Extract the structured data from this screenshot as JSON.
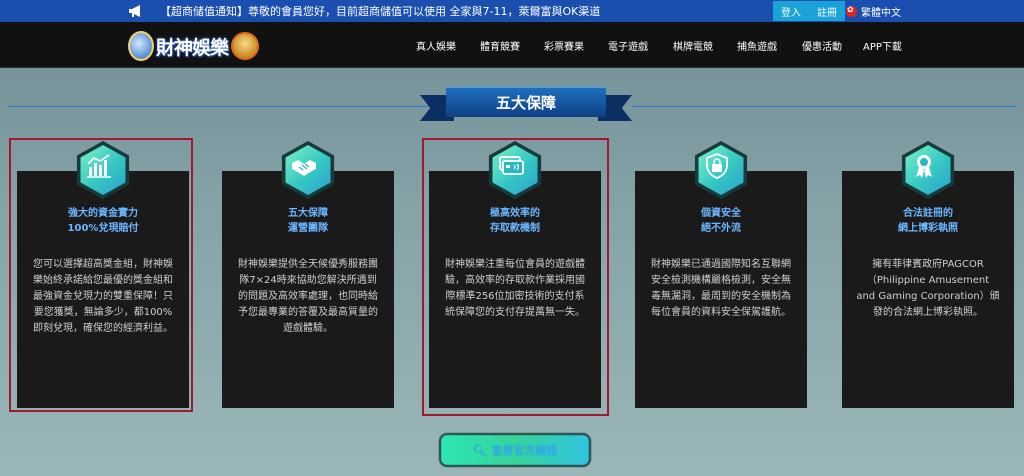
{
  "topbar": {
    "announcement": "【超商储值通知】尊敬的會員您好，目前超商儲值可以使用 全家與7-11，萊爾富與OK渠道",
    "login": "登入",
    "register": "註冊",
    "language": "繁體中文"
  },
  "brand": {
    "logo_text": "財神娛樂"
  },
  "nav": [
    "真人娛樂",
    "體育競賽",
    "彩票賽果",
    "電子遊戲",
    "棋牌電競",
    "捕魚遊戲",
    "優惠活動",
    "APP下載"
  ],
  "section": {
    "title": "五大保障"
  },
  "cards": [
    {
      "icon": "bar-chart-icon",
      "title_line1": "強大的資金實力",
      "title_line2": "100%兌現賠付",
      "desc": "您可以選擇超高獎金組，財神娛樂始終承諾給您最優的獎金組和最強資金兌現力的雙重保障！只要您獲獎，無論多少，都100%即刻兌現，確保您的經濟利益。"
    },
    {
      "icon": "handshake-icon",
      "title_line1": "五大保障",
      "title_line2": "運營團隊",
      "desc": "財神娛樂提供全天候優秀服務團隊7×24時來協助您解決所遇到的問題及高效率處理，也同時給予您最專業的答覆及最高質量的遊戲體驗。"
    },
    {
      "icon": "credit-card-icon",
      "title_line1": "極高效率的",
      "title_line2": "存取款機制",
      "desc": "財神娛樂注重每位會員的遊戲體驗，高效率的存取款作業採用國際標準256位加密技術的支付系統保障您的支付存提萬無一失。"
    },
    {
      "icon": "lock-shield-icon",
      "title_line1": "個資安全",
      "title_line2": "絕不外流",
      "desc": "財神娛樂已通過國際知名互聯網安全檢測機構嚴格檢測，安全無毒無漏洞，最周到的安全機制為每位會員的資料安全保駕護航。"
    },
    {
      "icon": "award-ribbon-icon",
      "title_line1": "合法註冊的",
      "title_line2": "網上博彩執照",
      "desc": "擁有菲律賓政府PAGCOR（Philippine Amusement and Gaming Corporation）頒發的合法網上博彩執照。"
    }
  ],
  "cta": {
    "label": "查看官方驗證"
  },
  "colors": {
    "accent": "#1a4fb0",
    "card_title": "#6bb6ff",
    "highlight": "#9e1b2c"
  }
}
